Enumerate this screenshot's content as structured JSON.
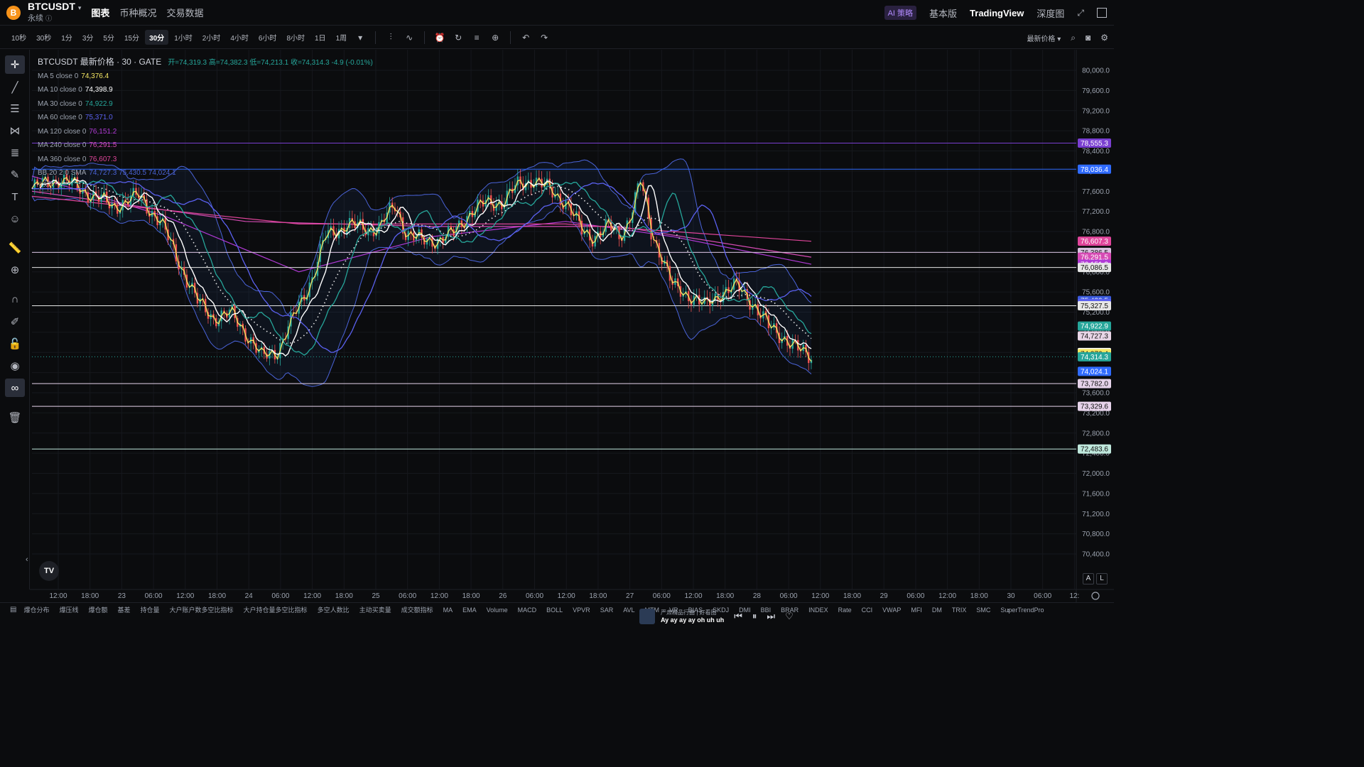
{
  "header": {
    "coin_icon": "B",
    "symbol": "BTCUSDT",
    "contract_type": "永续",
    "tabs": [
      "图表",
      "币种概况",
      "交易数据"
    ],
    "active_tab": 0,
    "right": {
      "ai_label": "AI 策略",
      "items": [
        "基本版",
        "TradingView",
        "深度图"
      ],
      "active_item": 1
    }
  },
  "toolbar": {
    "timeframes": [
      "10秒",
      "30秒",
      "1分",
      "3分",
      "5分",
      "15分",
      "30分",
      "1小时",
      "2小时",
      "4小时",
      "6小时",
      "8小时",
      "1日",
      "1周"
    ],
    "active_timeframe": 6,
    "price_type": "最新价格"
  },
  "legend": {
    "title": "BTCUSDT 最新价格 · 30 · GATE",
    "ohlc": "开=74,319.3  高=74,382.3  低=74,213.1  收=74,314.3  -4.9 (-0.01%)",
    "indicators": [
      {
        "name": "MA 5 close 0",
        "value": "74,376.4",
        "color": "#f5e663"
      },
      {
        "name": "MA 10 close 0",
        "value": "74,398.9",
        "color": "#ffffff"
      },
      {
        "name": "MA 30 close 0",
        "value": "74,922.9",
        "color": "#26a69a"
      },
      {
        "name": "MA 60 close 0",
        "value": "75,371.0",
        "color": "#5b61f0"
      },
      {
        "name": "MA 120 close 0",
        "value": "76,151.2",
        "color": "#b13ad6"
      },
      {
        "name": "MA 240 close 0",
        "value": "76,291.5",
        "color": "#d64bb4"
      },
      {
        "name": "MA 360 close 0",
        "value": "76,607.3",
        "color": "#e0459b"
      },
      {
        "name": "BB 20 2 0 SMA",
        "value": "74,727.3  75,430.5  74,024.1",
        "color": "#4a63d8"
      }
    ]
  },
  "price_axis": {
    "ticks": [
      "80,000.0",
      "79,600.0",
      "79,200.0",
      "78,800.0",
      "78,400.0",
      "78,000.0",
      "77,600.0",
      "77,200.0",
      "76,800.0",
      "76,400.0",
      "76,000.0",
      "75,600.0",
      "75,200.0",
      "74,800.0",
      "74,400.0",
      "74,000.0",
      "73,600.0",
      "73,200.0",
      "72,800.0",
      "72,400.0",
      "72,000.0",
      "71,600.0",
      "71,200.0",
      "70,800.0",
      "70,400.0"
    ],
    "labels": [
      {
        "price": 78555.3,
        "text": "78,555.3",
        "bg": "#7a3fd1",
        "fg": "#ffffff"
      },
      {
        "price": 78036.4,
        "text": "78,036.4",
        "bg": "#2f6bff",
        "fg": "#ffffff"
      },
      {
        "price": 76607.3,
        "text": "76,607.3",
        "bg": "#e0459b",
        "fg": "#ffffff"
      },
      {
        "price": 76386.5,
        "text": "76,386.5",
        "bg": "#d9c2e0",
        "fg": "#111111"
      },
      {
        "price": 76291.5,
        "text": "76,291.5",
        "bg": "#d64bb4",
        "fg": "#ffffff"
      },
      {
        "price": 76151.2,
        "text": "76,151.2",
        "bg": "#b13ad6",
        "fg": "#ffffff"
      },
      {
        "price": 76086.5,
        "text": "76,086.5",
        "bg": "#e6e6e6",
        "fg": "#111111"
      },
      {
        "price": 75430.5,
        "text": "75,430.5",
        "bg": "#3b5bdb",
        "fg": "#ffffff"
      },
      {
        "price": 75371.0,
        "text": "75,371.0",
        "bg": "#5b61f0",
        "fg": "#ffffff"
      },
      {
        "price": 75327.5,
        "text": "75,327.5",
        "bg": "#e6e6e6",
        "fg": "#111111"
      },
      {
        "price": 74922.9,
        "text": "74,922.9",
        "bg": "#26a69a",
        "fg": "#ffffff"
      },
      {
        "price": 74727.3,
        "text": "74,727.3",
        "bg": "#e8d5e6",
        "fg": "#111111"
      },
      {
        "price": 74398.9,
        "text": "74,398.9",
        "bg": "#ffffff",
        "fg": "#111111"
      },
      {
        "price": 74376.4,
        "text": "74,376.4",
        "bg": "#f5e663",
        "fg": "#111111"
      },
      {
        "price": 74314.3,
        "text": "74,314.3",
        "bg": "#26a69a",
        "fg": "#ffffff"
      },
      {
        "price": 74024.1,
        "text": "74,024.1",
        "bg": "#2f6bff",
        "fg": "#ffffff"
      },
      {
        "price": 73782.0,
        "text": "73,782.0",
        "bg": "#e6d3ea",
        "fg": "#111111"
      },
      {
        "price": 73329.6,
        "text": "73,329.6",
        "bg": "#e6d3ea",
        "fg": "#111111"
      },
      {
        "price": 72483.6,
        "text": "72,483.6",
        "bg": "#bfe8dc",
        "fg": "#111111"
      }
    ]
  },
  "time_axis": [
    "12:00",
    "18:00",
    "23",
    "06:00",
    "12:00",
    "18:00",
    "24",
    "06:00",
    "12:00",
    "18:00",
    "25",
    "06:00",
    "12:00",
    "18:00",
    "26",
    "06:00",
    "12:00",
    "18:00",
    "27",
    "06:00",
    "12:00",
    "18:00",
    "28",
    "06:00",
    "12:00",
    "18:00",
    "29",
    "06:00",
    "12:00",
    "18:00",
    "30",
    "06:00",
    "12:"
  ],
  "chart_data": {
    "type": "candlestick",
    "symbol": "BTCUSDT",
    "interval": "30",
    "exchange": "GATE",
    "ylim": [
      70400,
      80000
    ],
    "last": {
      "open": 74319.3,
      "high": 74382.3,
      "low": 74213.1,
      "close": 74314.3,
      "change": -4.9,
      "change_pct": -0.01
    },
    "horizontal_lines": [
      {
        "price": 78555.3,
        "color": "#7a3fd1"
      },
      {
        "price": 78036.4,
        "color": "#2f6bff"
      },
      {
        "price": 76386.5,
        "color": "#d9c2e0"
      },
      {
        "price": 76086.5,
        "color": "#e6e6e6"
      },
      {
        "price": 75327.5,
        "color": "#e6e6e6"
      },
      {
        "price": 73782.0,
        "color": "#e6d3ea"
      },
      {
        "price": 73329.6,
        "color": "#e6d3ea"
      },
      {
        "price": 72483.6,
        "color": "#bfe8dc"
      }
    ],
    "close_path": [
      [
        0,
        77650
      ],
      [
        10,
        77850
      ],
      [
        20,
        77600
      ],
      [
        30,
        77300
      ],
      [
        40,
        77500
      ],
      [
        48,
        77000
      ],
      [
        55,
        76200
      ],
      [
        62,
        75400
      ],
      [
        68,
        75100
      ],
      [
        75,
        75150
      ],
      [
        80,
        74800
      ],
      [
        86,
        74300
      ],
      [
        92,
        74450
      ],
      [
        98,
        75100
      ],
      [
        105,
        75900
      ],
      [
        110,
        76700
      ],
      [
        118,
        76950
      ],
      [
        124,
        76850
      ],
      [
        130,
        76900
      ],
      [
        136,
        77300
      ],
      [
        140,
        76800
      ],
      [
        146,
        76600
      ],
      [
        152,
        76650
      ],
      [
        158,
        76750
      ],
      [
        164,
        77200
      ],
      [
        170,
        77350
      ],
      [
        176,
        77400
      ],
      [
        182,
        77700
      ],
      [
        188,
        77850
      ],
      [
        194,
        77600
      ],
      [
        200,
        77400
      ],
      [
        206,
        76800
      ],
      [
        210,
        76700
      ],
      [
        216,
        76900
      ],
      [
        220,
        76700
      ],
      [
        224,
        77100
      ],
      [
        228,
        77800
      ],
      [
        232,
        76800
      ],
      [
        236,
        76300
      ],
      [
        240,
        75700
      ],
      [
        244,
        75600
      ],
      [
        248,
        75500
      ],
      [
        252,
        75300
      ],
      [
        258,
        75600
      ],
      [
        264,
        75700
      ],
      [
        270,
        75400
      ],
      [
        276,
        74900
      ],
      [
        282,
        74700
      ],
      [
        288,
        74400
      ],
      [
        292,
        74314
      ]
    ],
    "series_ma": [
      {
        "name": "MA 5",
        "color": "#f5e663",
        "lag": 0,
        "smooth": 1
      },
      {
        "name": "MA 10",
        "color": "#ffffff",
        "lag": 3,
        "smooth": 2
      },
      {
        "name": "MA 30",
        "color": "#26a69a",
        "lag": 10,
        "smooth": 5
      },
      {
        "name": "MA 60",
        "color": "#5b61f0",
        "lag": 20,
        "smooth": 9
      }
    ],
    "long_ma": [
      {
        "name": "MA 120",
        "color": "#b13ad6",
        "points": [
          [
            0,
            77900
          ],
          [
            50,
            77100
          ],
          [
            100,
            76000
          ],
          [
            150,
            76700
          ],
          [
            200,
            77000
          ],
          [
            240,
            76700
          ],
          [
            292,
            76151
          ]
        ]
      },
      {
        "name": "MA 240",
        "color": "#d64bb4",
        "points": [
          [
            0,
            77600
          ],
          [
            80,
            77000
          ],
          [
            150,
            76900
          ],
          [
            220,
            76900
          ],
          [
            292,
            76291
          ]
        ]
      },
      {
        "name": "MA 360",
        "color": "#e0459b",
        "points": [
          [
            0,
            77500
          ],
          [
            100,
            76950
          ],
          [
            200,
            76950
          ],
          [
            292,
            76607
          ]
        ]
      }
    ]
  },
  "bottom_bar": {
    "indicators": [
      "爆仓分布",
      "爆压线",
      "爆仓额",
      "基差",
      "持仓量",
      "大户账户数多空比指标",
      "大户持仓量多空比指标",
      "多空人数比",
      "主动买卖量",
      "成交额指标",
      "MA",
      "EMA",
      "Volume",
      "MACD",
      "BOLL",
      "VPVR",
      "SAR",
      "AVL",
      "MTM",
      "VR",
      "BIAS",
      "SKDJ",
      "DMI",
      "BBI",
      "BRAR",
      "INDEX",
      "Rate",
      "CCI",
      "VWAP",
      "MFI",
      "DM",
      "TRIX",
      "SMC",
      "SuperTrendPro"
    ],
    "media_title": "严肃精品行曲 | 好看图",
    "media_subtitle": "Ay ay ay ay oh uh uh"
  },
  "axis_buttons": [
    "A",
    "L"
  ]
}
